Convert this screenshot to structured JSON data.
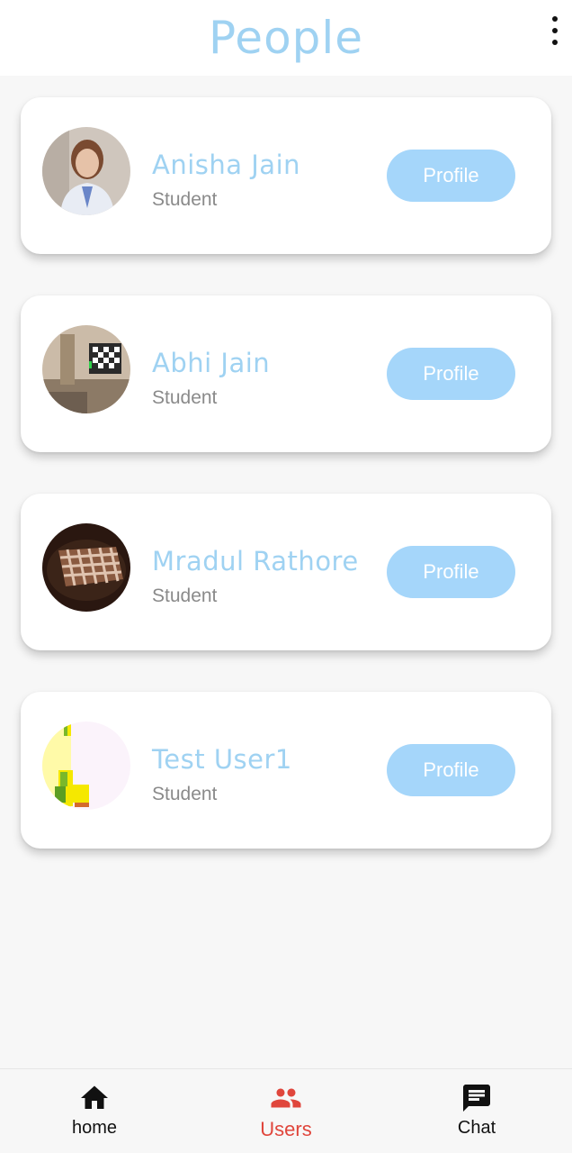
{
  "appbar": {
    "title": "People",
    "menu_icon": "more-vert-icon"
  },
  "people": [
    {
      "name": "Anisha Jain",
      "role": "Student",
      "button_label": "Profile",
      "avatar": "portrait-photo"
    },
    {
      "name": "Abhi Jain",
      "role": "Student",
      "button_label": "Profile",
      "avatar": "room-photo"
    },
    {
      "name": "Mradul Rathore",
      "role": "Student",
      "button_label": "Profile",
      "avatar": "waffle-photo"
    },
    {
      "name": "Test User1",
      "role": "Student",
      "button_label": "Profile",
      "avatar": "pixel-image"
    }
  ],
  "bottom_nav": {
    "items": [
      {
        "label": "home",
        "icon": "home-icon",
        "active": false
      },
      {
        "label": "Users",
        "icon": "users-icon",
        "active": true
      },
      {
        "label": "Chat",
        "icon": "chat-icon",
        "active": false
      }
    ]
  },
  "colors": {
    "accent": "#9fd2f2",
    "button": "#a5d6fa",
    "active_nav": "#e0463c",
    "background": "#f7f7f7"
  }
}
